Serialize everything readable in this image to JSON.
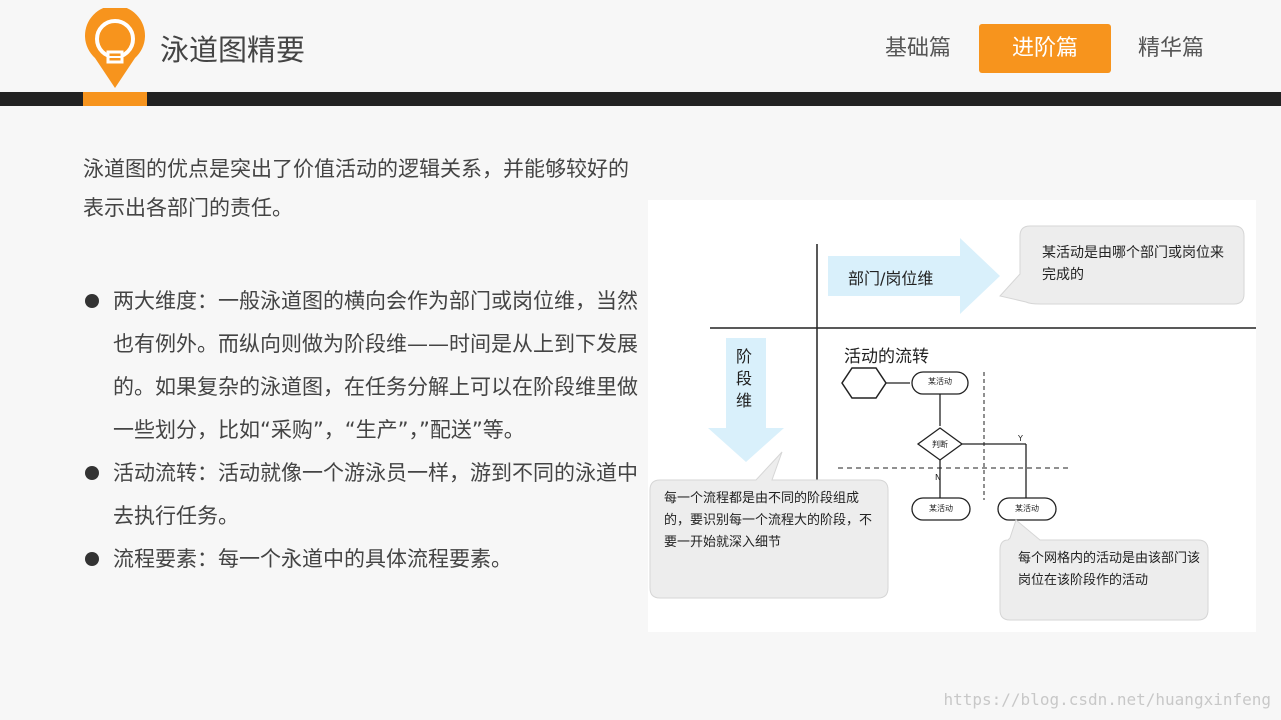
{
  "header": {
    "title": "泳道图精要",
    "nav": [
      {
        "label": "基础篇",
        "active": false
      },
      {
        "label": "进阶篇",
        "active": true
      },
      {
        "label": "精华篇",
        "active": false
      }
    ],
    "accent_color": "#f7941d",
    "icon": "lightbulb-icon"
  },
  "intro": "泳道图的优点是突出了价值活动的逻辑关系，并能够较好的表示出各部门的责任。",
  "bullets": [
    "两大维度：一般泳道图的横向会作为部门或岗位维，当然也有例外。而纵向则做为阶段维——时间是从上到下发展的。如果复杂的泳道图，在任务分解上可以在阶段维里做一些划分，比如“采购”，“生产”，”配送”等。",
    "活动流转：活动就像一个游泳员一样，游到不同的泳道中去执行任务。",
    "流程要素：每一个永道中的具体流程要素。"
  ],
  "diagram": {
    "dept_arrow": "部门/岗位维",
    "dept_note": "某活动是由哪个部门或岗位来完成的",
    "stage_arrow": "阶段维",
    "flow_title": "活动的流转",
    "nodes": {
      "activity1": "某活动",
      "decision": "判断",
      "activity2": "某活动",
      "activity3": "某活动"
    },
    "branch_yes": "Y",
    "branch_no": "N",
    "stage_note": "每一个流程都是由不同的阶段组成的，要识别每一个流程大的阶段，不要一开始就深入细节",
    "cell_note": "每个网格内的活动是由该部门该岗位在该阶段作的活动"
  },
  "watermark": "https://blog.csdn.net/huangxinfeng"
}
